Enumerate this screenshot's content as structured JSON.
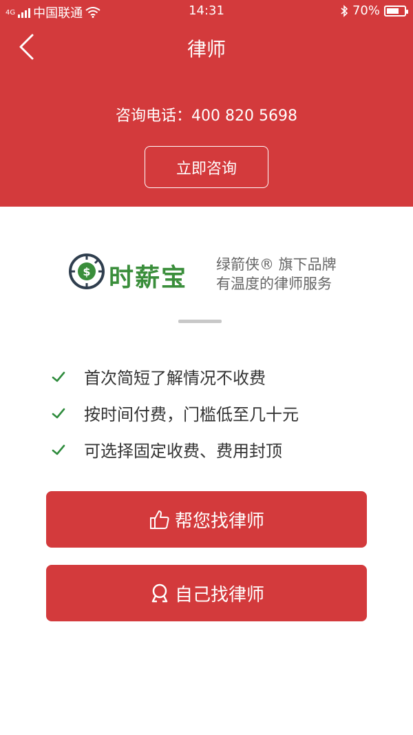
{
  "status_bar": {
    "carrier": "中国联通",
    "network": "4G",
    "time": "14:31",
    "battery": "70%",
    "battery_level": 0.7
  },
  "header": {
    "title": "律师",
    "phone_line": "咨询电话：400 820 5698",
    "consult_button": "立即咨询"
  },
  "brand": {
    "name": "时薪宝",
    "tagline_1": "绿箭侠® 旗下品牌",
    "tagline_2": "有温度的律师服务"
  },
  "features": [
    "首次简短了解情况不收费",
    "按时间付费，门槛低至几十元",
    "可选择固定收费、费用封顶"
  ],
  "actions": {
    "help_find": "帮您找律师",
    "self_find": "自己找律师"
  },
  "colors": {
    "primary": "#d33a3c",
    "brand_green": "#3a8e3b",
    "check_green": "#2e8b3c"
  }
}
